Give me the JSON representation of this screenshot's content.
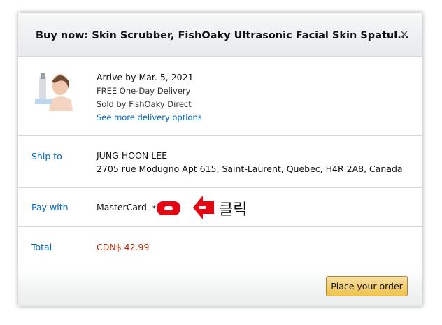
{
  "modal": {
    "title": "Buy now: Skin Scrubber, FishOaky Ultrasonic Facial Skin Spatul...",
    "close_label": "×"
  },
  "delivery": {
    "arrive": "Arrive by Mar. 5, 2021",
    "shipping": "FREE One-Day Delivery",
    "seller": "Sold by FishOaky Direct",
    "more_options": "See more delivery options"
  },
  "ship_to": {
    "label": "Ship to",
    "name": "JUNG HOON LEE",
    "address": "2705 rue Modugno Apt 615, Saint-Laurent, Quebec, H4R 2A8, Canada"
  },
  "pay_with": {
    "label": "Pay with",
    "method": "MasterCard",
    "masked": "*."
  },
  "total": {
    "label": "Total",
    "amount": "CDN$ 42.99"
  },
  "footer": {
    "place_order_label": "Place your order"
  },
  "annotation": {
    "text": "클릭",
    "color": "#e30613"
  }
}
